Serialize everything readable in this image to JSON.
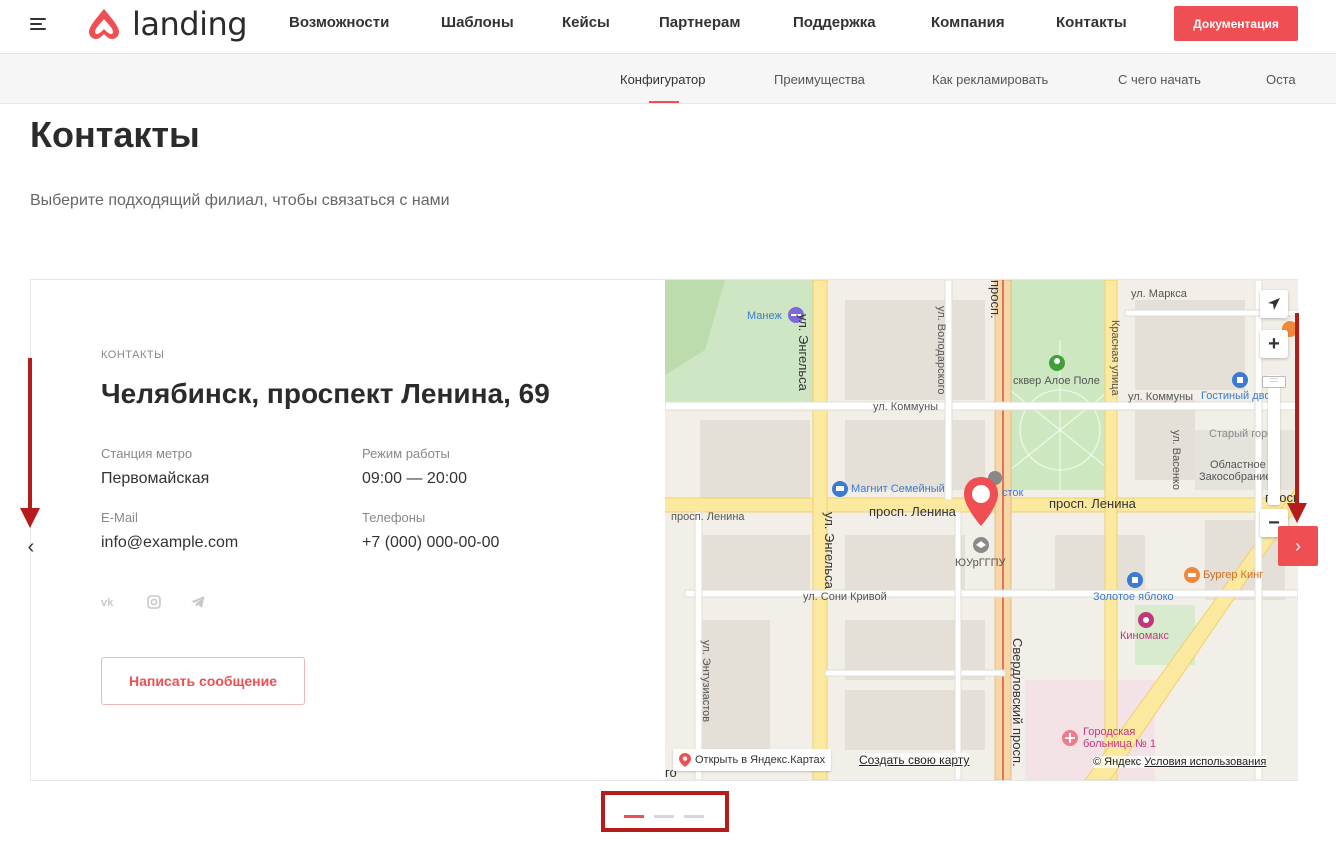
{
  "header": {
    "logo_text": "landing",
    "nav": [
      "Возможности",
      "Шаблоны",
      "Кейсы",
      "Партнерам",
      "Поддержка",
      "Компания",
      "Контакты"
    ],
    "docs_button": "Документация"
  },
  "subnav": {
    "items": [
      "Конфигуратор",
      "Преимущества",
      "Как рекламировать",
      "С чего начать",
      "Оста"
    ],
    "active": "Конфигуратор"
  },
  "page": {
    "title": "Контакты",
    "subtitle": "Выберите подходящий филиал, чтобы связаться с нами"
  },
  "card": {
    "label": "КОНТАКТЫ",
    "address": "Челябинск, проспект Ленина, 69",
    "metro_label": "Станция метро",
    "metro_value": "Первомайская",
    "hours_label": "Режим работы",
    "hours_value": "09:00 — 20:00",
    "email_label": "E-Mail",
    "email_value": "info@example.com",
    "phones_label": "Телефоны",
    "phones_value": "+7 (000) 000-00-00",
    "socials": [
      "vk-icon",
      "instagram-icon",
      "telegram-icon"
    ],
    "message_button": "Написать сообщение"
  },
  "map": {
    "labels": {
      "manezh": "Манеж",
      "engelsa": "ул. Энгельса",
      "volodarskogo": "ул. Володарского",
      "sverdlovsky_top": "просп.",
      "marksa": "ул. Маркса",
      "krasnaya": "Красная улица",
      "aloe": "сквер Алое Поле",
      "kommuny": "ул. Коммуны",
      "kommuny2": "ул. Коммуны",
      "gostiny": "Гостиный двор",
      "stary_gorod": "Старый город",
      "oblastnoe1": "Областное",
      "oblastnoe2": "Закособрание",
      "vasenko": "ул. Васенко",
      "magnit": "Магнит Семейный",
      "stok": "сток",
      "lenina_left": "просп. Ленина",
      "lenina_mid": "просп. Ленина",
      "lenina_right": "просп. Ленина",
      "lenina_far": "просп",
      "yurggpu": "ЮУрГГПУ",
      "sony": "ул. Сони Кривой",
      "burger": "Бургер Кинг",
      "zoloto": "Золотое яблоко",
      "kinomaks": "Киномакс",
      "engelsa2": "ул. Энгельса",
      "entuziastov": "ул. Энтузиастов",
      "sverdlovsky": "Свердловский просп.",
      "hospital1": "Городская",
      "hospital2": "больница № 1",
      "go": "го"
    },
    "open_yandex": "Открыть в Яндекс.Картах",
    "create_map": "Создать свою карту",
    "copyright": "© Яндекс",
    "terms": "Условия использования"
  },
  "slider": {
    "prev": "‹",
    "next": "›",
    "dots": 3,
    "active_dot": 0
  },
  "colors": {
    "accent": "#ef4f53",
    "annotation": "#b71c1c"
  }
}
